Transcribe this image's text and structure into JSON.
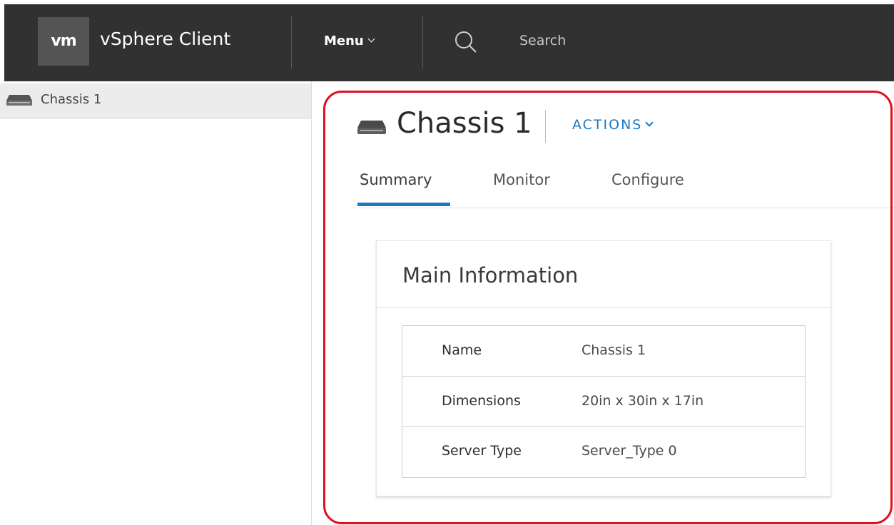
{
  "header": {
    "logo_text": "vm",
    "app_title": "vSphere Client",
    "menu_label": "Menu",
    "search_placeholder": "Search",
    "bg_color": "#313131"
  },
  "sidebar": {
    "items": [
      {
        "label": "Chassis 1",
        "icon": "chassis-icon",
        "selected": true
      }
    ]
  },
  "main": {
    "title": "Chassis 1",
    "title_icon": "chassis-icon",
    "actions_label": "ACTIONS",
    "tabs": [
      {
        "label": "Summary",
        "active": true
      },
      {
        "label": "Monitor",
        "active": false
      },
      {
        "label": "Configure",
        "active": false
      }
    ],
    "accent_color": "#1a7bc3"
  },
  "card": {
    "title": "Main Information",
    "rows": [
      {
        "key": "Name",
        "value": "Chassis 1"
      },
      {
        "key": "Dimensions",
        "value": "20in x 30in x 17in"
      },
      {
        "key": "Server Type",
        "value": "Server_Type 0"
      }
    ]
  },
  "highlight_color": "#e0101e"
}
